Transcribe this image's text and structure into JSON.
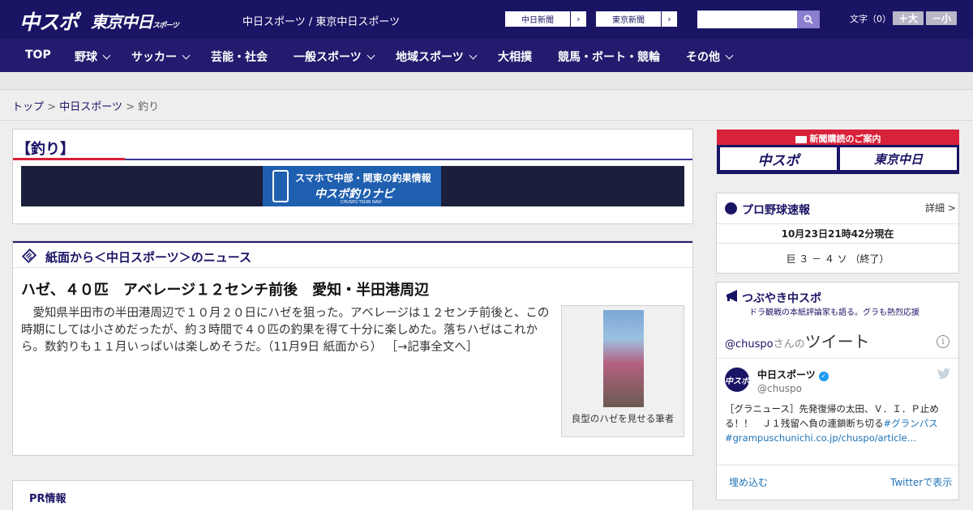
{
  "header": {
    "logo_chuspo": "中スポ",
    "logo_tokyo": "東京中日",
    "logo_tokyo_small": "スポーツ",
    "site_title": "中日スポーツ / 東京中日スポーツ",
    "ext_links": [
      {
        "label": "中日新聞",
        "arrow": "›"
      },
      {
        "label": "東京新聞",
        "arrow": "›"
      }
    ],
    "search_placeholder": "",
    "fontsize_label": "文字（0）",
    "font_larger": "＋大",
    "font_smaller": "－小"
  },
  "nav": [
    {
      "label": "TOP",
      "has_menu": false
    },
    {
      "label": "野球",
      "has_menu": true
    },
    {
      "label": "サッカー",
      "has_menu": true
    },
    {
      "label": "芸能・社会",
      "has_menu": false
    },
    {
      "label": "一般スポーツ",
      "has_menu": true
    },
    {
      "label": "地域スポーツ",
      "has_menu": true
    },
    {
      "label": "大相撲",
      "has_menu": false
    },
    {
      "label": "競馬・ボート・競輪",
      "has_menu": false
    },
    {
      "label": "その他",
      "has_menu": true
    }
  ],
  "breadcrumb": {
    "top": "トップ",
    "sep": ">",
    "section": "中日スポーツ",
    "current": "釣り"
  },
  "category": {
    "title": "【釣り】",
    "banner_line1": "スマホで中部・関東の釣果情報",
    "banner_line2": "中スポ釣りナビ",
    "banner_line3": "CHUSPO TSURI NAVI"
  },
  "news": {
    "section_title": "紙面から＜中日スポーツ＞のニュース",
    "article_title": "ハゼ、４０匹　アベレージ１２センチ前後　愛知・半田港周辺",
    "article_body": "　愛知県半田市の半田港周辺で１０月２０日にハゼを狙った。アベレージは１２センチ前後と、この時期にしては小さめだったが、約３時間で４０匹の釣果を得て十分に楽しめた。落ちハゼはこれから。数釣りも１１月いっぱいは楽しめそうだ。（11月9日 紙面から）",
    "read_more": "［→記事全文へ］",
    "photo_caption": "良型のハゼを見せる筆者"
  },
  "pr": {
    "title": "PR情報"
  },
  "sidebar": {
    "subscribe": {
      "label": "新聞購読のご案内",
      "logo1": "中スポ",
      "logo2": "東京中日"
    },
    "baseball": {
      "title": "プロ野球速報",
      "detail": "詳細 >",
      "timestamp": "10月23日21時42分現在",
      "score": "巨 ３ － ４ ソ （終了）"
    },
    "tweets": {
      "title": "つぶやき中スポ",
      "subtitle": "ドラ観戦の本紙評論家も語る。グラも熱烈応援",
      "embed_user": "@chuspo",
      "embed_suffix": "さんの",
      "embed_word": "ツイート",
      "info": "i",
      "author_name": "中日スポーツ",
      "author_handle": "@chuspo",
      "avatar_text": "中スポ",
      "verified_mark": "✓",
      "tweet_text": "［グラニュース］先発復帰の太田、Ｖ．Ｉ．Ｐ止める！！　Ｊ１残留へ負の連鎖断ち切る",
      "tweet_hashtag": "#グランパス",
      "tweet_link": "#grampuschunichi.co.jp/chuspo/article…",
      "embed_link": "埋め込む",
      "view_link": "Twitterで表示"
    }
  },
  "colors": {
    "brand_navy": "#1a1465",
    "accent_red": "#d8213a",
    "twitter_blue": "#1d9bf0"
  }
}
